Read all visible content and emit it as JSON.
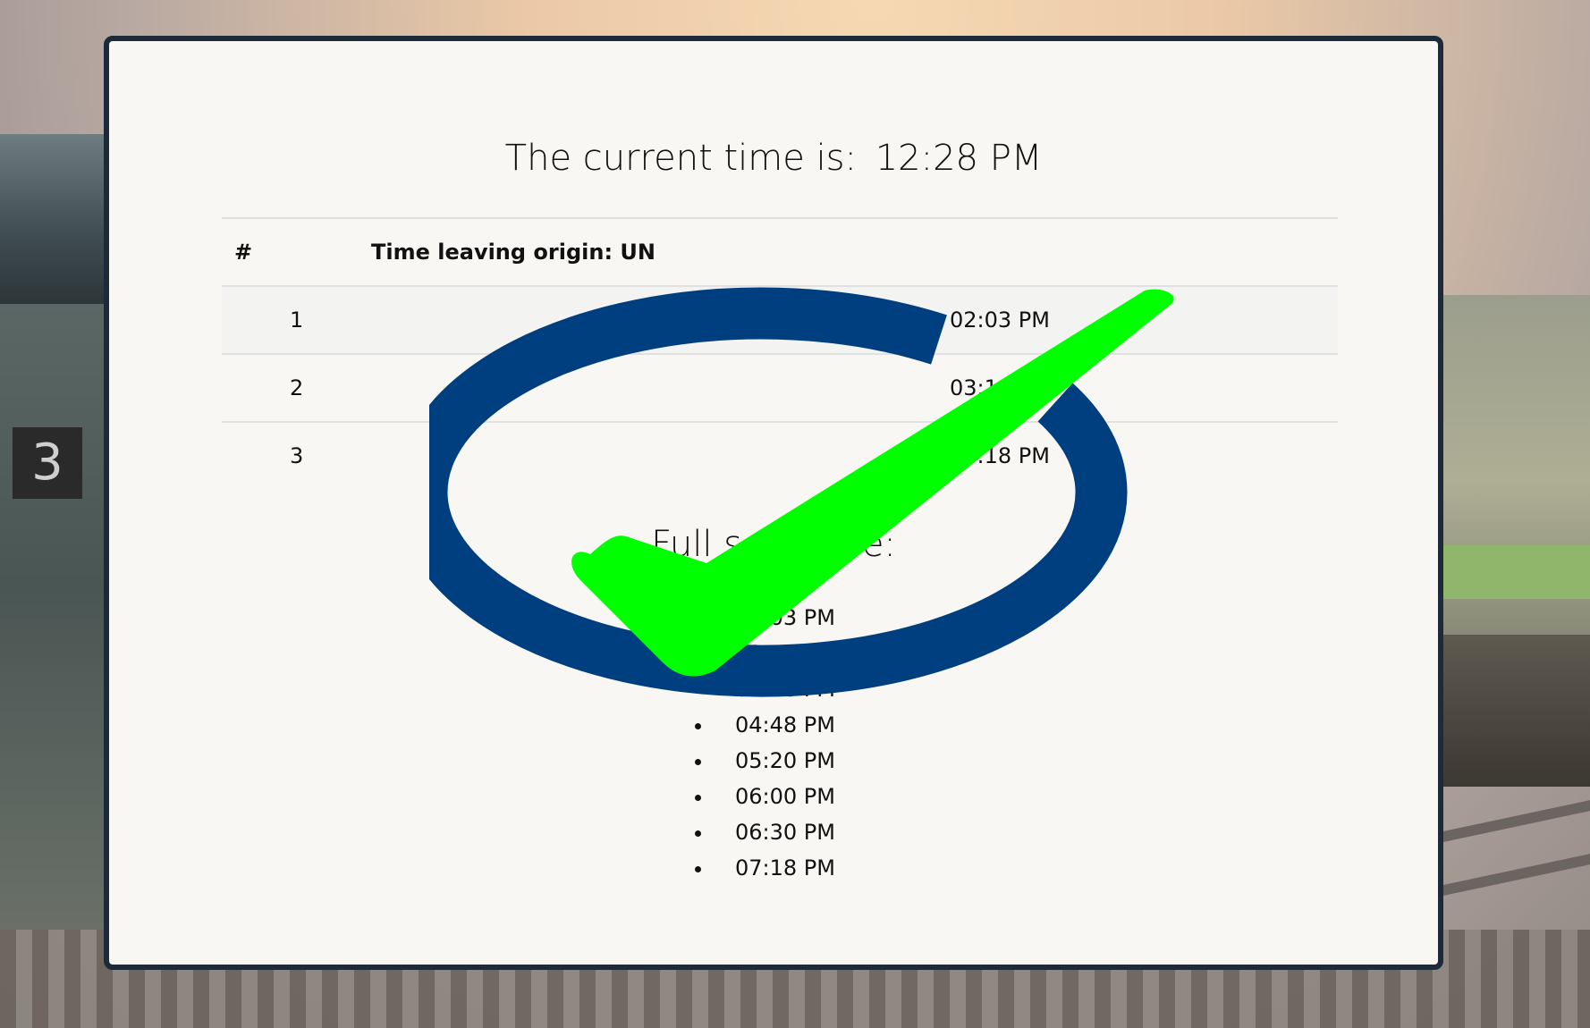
{
  "background": {
    "platform_number": "3"
  },
  "header": {
    "current_time_label": "The current time is:",
    "current_time_value": "12:28 PM"
  },
  "table": {
    "columns": [
      "#",
      "Time leaving origin: UN"
    ],
    "rows": [
      {
        "num": "1",
        "time": "02:03 PM"
      },
      {
        "num": "2",
        "time": "03:11 PM"
      },
      {
        "num": "3",
        "time": "04:18 PM"
      }
    ]
  },
  "full_schedule": {
    "heading": "Full schedule:",
    "times": [
      "02:03 PM",
      "03:11 PM",
      "04:18 PM",
      "04:48 PM",
      "05:20 PM",
      "06:00 PM",
      "06:30 PM",
      "07:18 PM"
    ]
  },
  "overlay": {
    "icon": "checkmark-logo-icon",
    "ring_color": "#003f7f",
    "check_color": "#00ff00"
  },
  "colors": {
    "card_border": "#1d2a3a",
    "card_background": "#f9f7f4",
    "stripe_row": "#f3f3f2"
  }
}
